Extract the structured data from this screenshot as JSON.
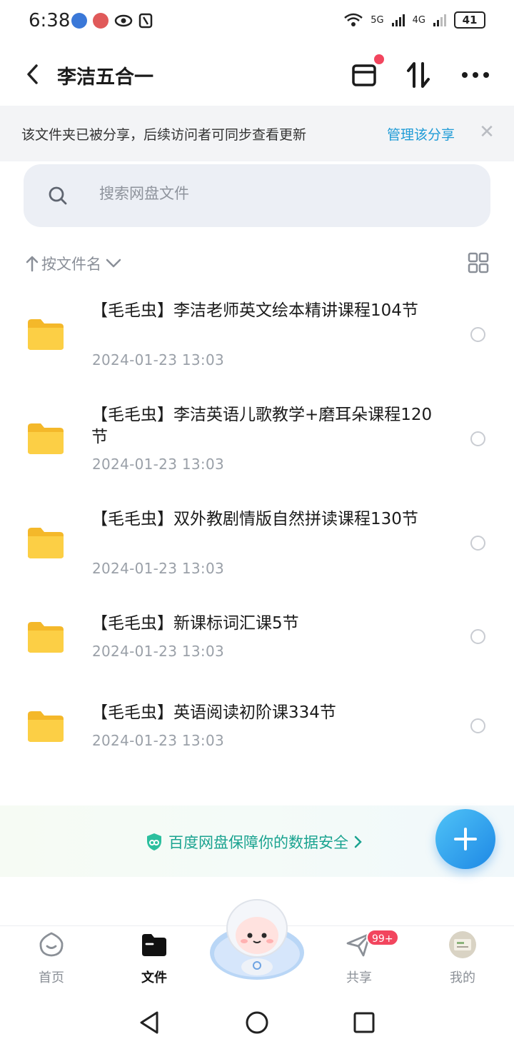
{
  "status_bar": {
    "time": "6:38",
    "battery": "41",
    "network_1": "5G",
    "network_2": "4G"
  },
  "header": {
    "title": "李洁五合一"
  },
  "share_banner": {
    "text": "该文件夹已被分享，后续访问者可同步查看更新",
    "link": "管理该分享"
  },
  "search": {
    "placeholder": "搜索网盘文件"
  },
  "sort": {
    "label": "按文件名"
  },
  "files": [
    {
      "name": "【毛毛虫】李洁老师英文绘本精讲课程104节",
      "date": "2024-01-23  13:03"
    },
    {
      "name": "【毛毛虫】李洁英语儿歌教学+磨耳朵课程120节",
      "date": "2024-01-23  13:03"
    },
    {
      "name": "【毛毛虫】双外教剧情版自然拼读课程130节",
      "date": "2024-01-23  13:03"
    },
    {
      "name": "【毛毛虫】新课标词汇课5节",
      "date": "2024-01-23  13:03"
    },
    {
      "name": "【毛毛虫】英语阅读初阶课334节",
      "date": "2024-01-23  13:03"
    }
  ],
  "promo": {
    "text": "百度网盘保障你的数据安全"
  },
  "bottom_nav": {
    "items": [
      {
        "label": "首页"
      },
      {
        "label": "文件"
      },
      {
        "label": "共享",
        "badge": "99+"
      },
      {
        "label": "我的"
      }
    ]
  },
  "colors": {
    "accent": "#1f9bd6",
    "folder": "#f7c232",
    "badge": "#f2455e",
    "promo_text": "#1aa390"
  }
}
